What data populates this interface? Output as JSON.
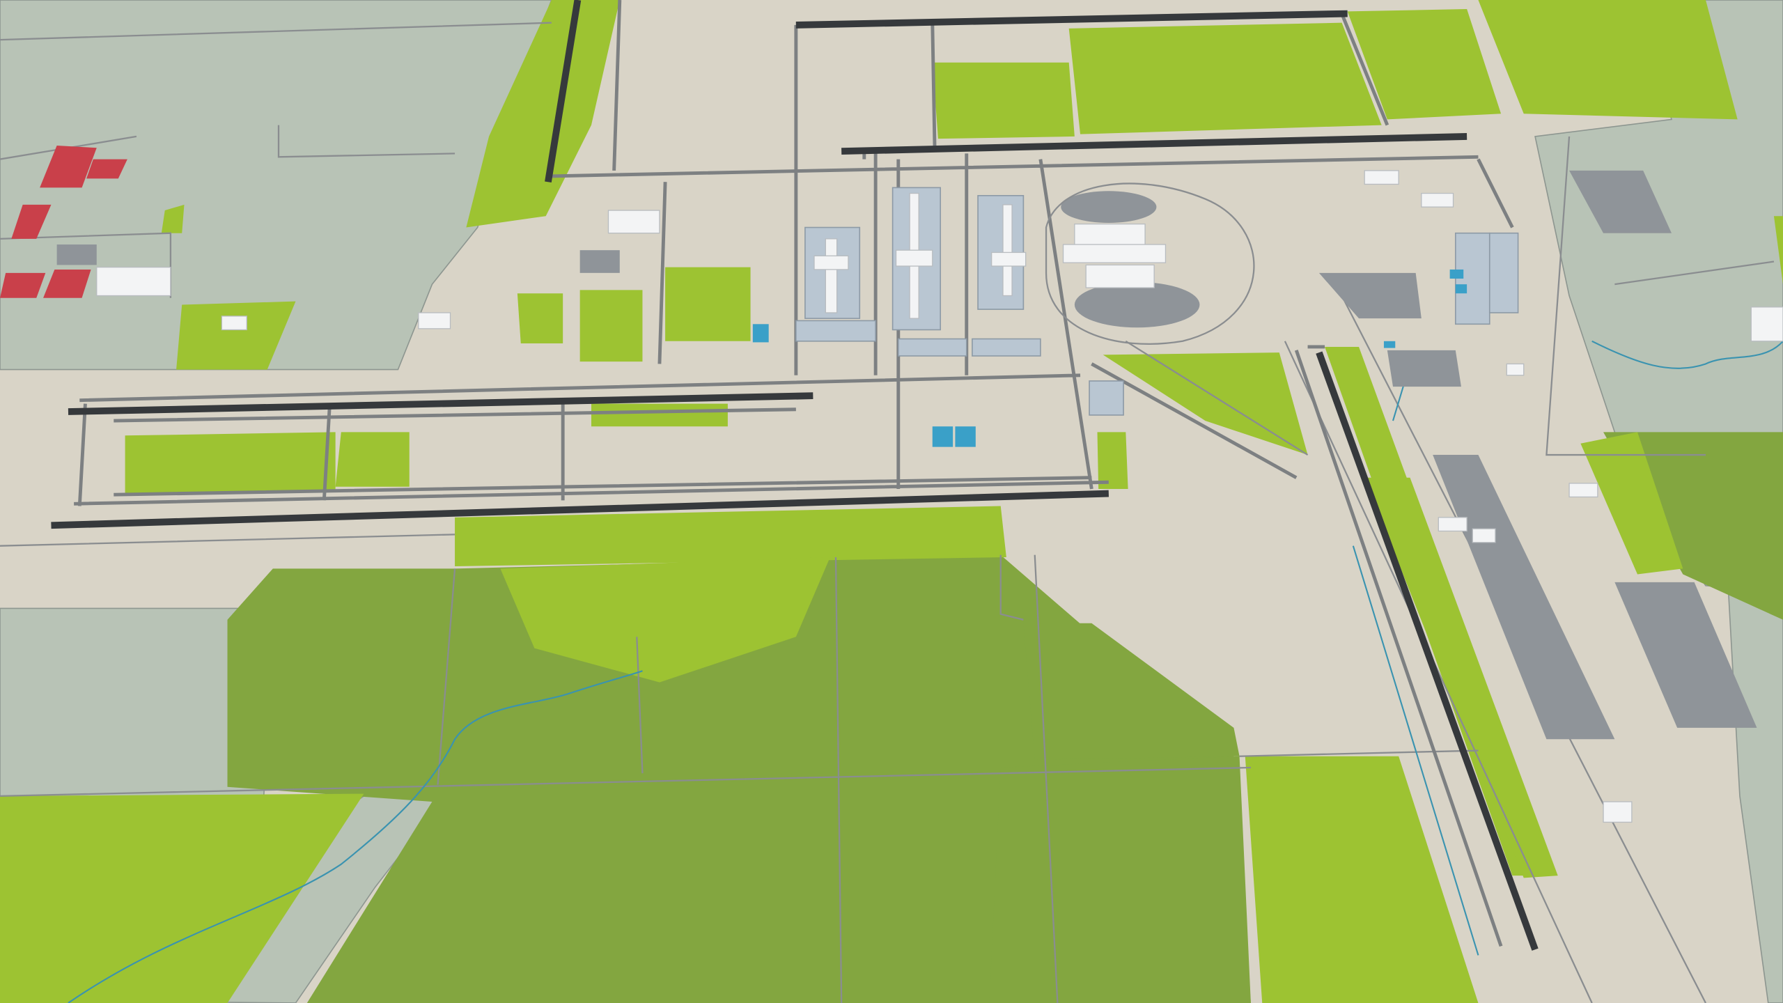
{
  "scene": {
    "subject": "airport-3d-model",
    "palette": {
      "ground": "#d9d4c7",
      "field_dark": "#83a640",
      "field_light": "#9dc332",
      "gray_land": "#b8c3b6",
      "runway": "#36393c",
      "taxiway": "#7d8082",
      "apron": "#b9c6d2",
      "water": "#3aa0c8"
    }
  }
}
